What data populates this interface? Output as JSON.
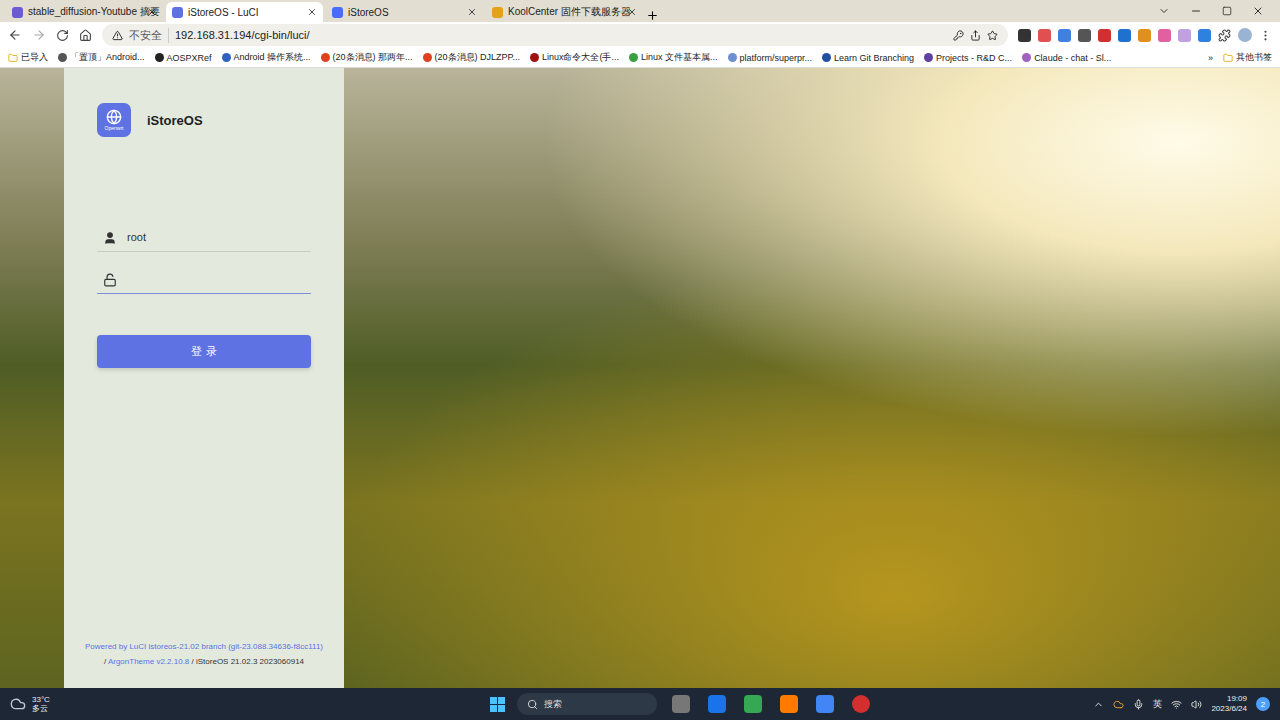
{
  "window": {
    "title": "iStoreOS - LuCI"
  },
  "tabs": [
    {
      "label": "stable_diffusion-Youtube 摘要",
      "selected": false
    },
    {
      "label": "iStoreOS - LuCI",
      "selected": true
    },
    {
      "label": "iStoreOS",
      "selected": false
    },
    {
      "label": "KoolCenter 固件下载服务器",
      "selected": false
    }
  ],
  "address_bar": {
    "security": "不安全",
    "url": "192.168.31.194/cgi-bin/luci/"
  },
  "bookmarks": [
    {
      "label": "已导入"
    },
    {
      "label": "「置顶」Android..."
    },
    {
      "label": "AOSPXRef"
    },
    {
      "label": "Android 操作系统..."
    },
    {
      "label": "(20条消息) 那两年..."
    },
    {
      "label": "(20条消息) DJLZPP..."
    },
    {
      "label": "Linux命令大全(手..."
    },
    {
      "label": "Linux 文件基本属..."
    },
    {
      "label": "platform/superpr..."
    },
    {
      "label": "Learn Git Branching"
    },
    {
      "label": "Projects - R&D C..."
    },
    {
      "label": "Claude - chat - Sl..."
    }
  ],
  "bookmarks_more": "»",
  "other_bookmarks": "其他书签",
  "login": {
    "brand": "iStoreOS",
    "logo_caption": "Openwrt",
    "fields": [
      {
        "kind": "user",
        "value": "root",
        "focused": false
      },
      {
        "kind": "lock",
        "value": "",
        "focused": true
      }
    ],
    "button": "登 录",
    "footer": [
      [
        {
          "text": "Powered by LuCI istoreos-21.02 branch (git-23.088.34636-f8cc111)",
          "link": true
        }
      ],
      [
        {
          "text": "/ ",
          "link": false
        },
        {
          "text": "ArgonTheme v2.2.10.8",
          "link": true
        },
        {
          "text": " / iStoreOS 21.02.3 2023060914",
          "link": false
        }
      ]
    ]
  },
  "taskbar": {
    "weather": {
      "temp": "33°C",
      "condition": "多云"
    },
    "search": "搜索",
    "input_method": "英",
    "time": "19:09",
    "date": "2023/6/24",
    "notifications": "2"
  }
}
